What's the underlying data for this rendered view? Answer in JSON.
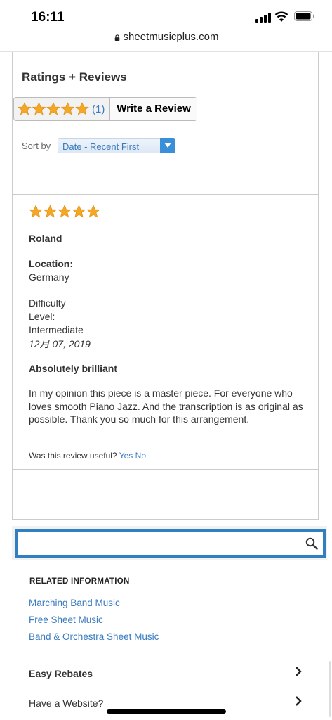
{
  "status": {
    "time": "16:11"
  },
  "browser": {
    "url": "sheetmusicplus.com"
  },
  "ratings": {
    "title": "Ratings + Reviews",
    "average_stars": 5,
    "count": "(1)",
    "write_review": "Write a Review",
    "sort_label": "Sort by",
    "sort_value": "Date - Recent First"
  },
  "review": {
    "stars": 5,
    "author": "Roland",
    "location_label": "Location:",
    "location": "Germany",
    "difficulty_line1": "Difficulty",
    "difficulty_line2": "Level:",
    "difficulty": "Intermediate",
    "date": "12月 07, 2019",
    "headline": "Absolutely brilliant",
    "body": "In my opinion this piece is a master piece. For everyone who loves smooth Piano Jazz. And the transcription is as original as possible. Thank you so much for this arrangement.",
    "useful_question": "Was this review useful?",
    "yes": "Yes",
    "no": "No"
  },
  "search": {
    "placeholder": ""
  },
  "related": {
    "heading": "RELATED INFORMATION",
    "links": [
      "Marching Band Music",
      "Free Sheet Music",
      "Band & Orchestra Sheet Music"
    ]
  },
  "accordion": {
    "items": [
      "Easy Rebates",
      "Have a Website?"
    ]
  },
  "colors": {
    "star": "#f5a623",
    "link": "#3a7bbf",
    "search_border": "#2f7fc1"
  },
  "icons": [
    "lock-icon",
    "star-icon",
    "chevron-down-icon",
    "search-icon",
    "chevron-right-icon"
  ]
}
